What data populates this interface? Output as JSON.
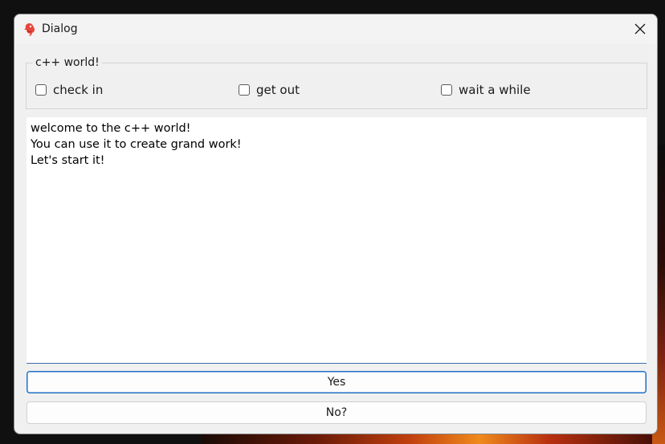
{
  "window": {
    "title": "Dialog"
  },
  "group": {
    "title": "c++ world!",
    "checkboxes": [
      {
        "label": "check in",
        "checked": false
      },
      {
        "label": "get out",
        "checked": false
      },
      {
        "label": "wait a while",
        "checked": false
      }
    ]
  },
  "editor": {
    "lines": [
      "welcome to the c++ world!",
      "You can use it to create grand work!",
      "Let's start it!"
    ]
  },
  "buttons": {
    "yes_label": "Yes",
    "no_label": "No?"
  },
  "colors": {
    "accent": "#1f6fc6",
    "window_bg": "#f0f0f0"
  }
}
